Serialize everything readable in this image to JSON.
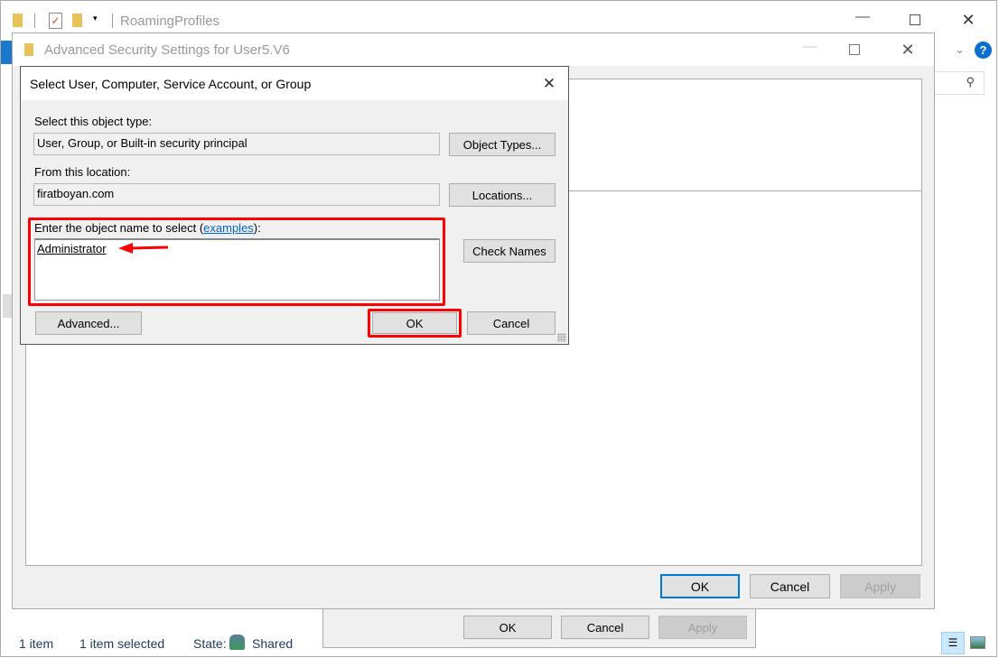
{
  "explorer": {
    "title": "RoamingProfiles",
    "status": {
      "items": "1 item",
      "selected": "1 item selected",
      "state_label": "State:",
      "state_value": "Shared"
    }
  },
  "advanced_security": {
    "title": "Advanced Security Settings for User5.V6",
    "ok": "OK",
    "cancel": "Cancel",
    "apply": "Apply"
  },
  "properties": {
    "ok": "OK",
    "cancel": "Cancel",
    "apply": "Apply"
  },
  "select_dialog": {
    "title": "Select User, Computer, Service Account, or Group",
    "object_type_label": "Select this object type:",
    "object_type_value": "User, Group, or Built-in security principal",
    "object_types_button": "Object Types...",
    "location_label": "From this location:",
    "location_value": "firatboyan.com",
    "locations_button": "Locations...",
    "name_label_prefix": "Enter the object name to select (",
    "name_label_link": "examples",
    "name_label_suffix": "):",
    "name_value": "Administrator",
    "check_names_button": "Check Names",
    "advanced_button": "Advanced...",
    "ok": "OK",
    "cancel": "Cancel"
  },
  "colors": {
    "highlight": "#ff0000",
    "accent": "#0078d7",
    "link": "#0066cc"
  }
}
